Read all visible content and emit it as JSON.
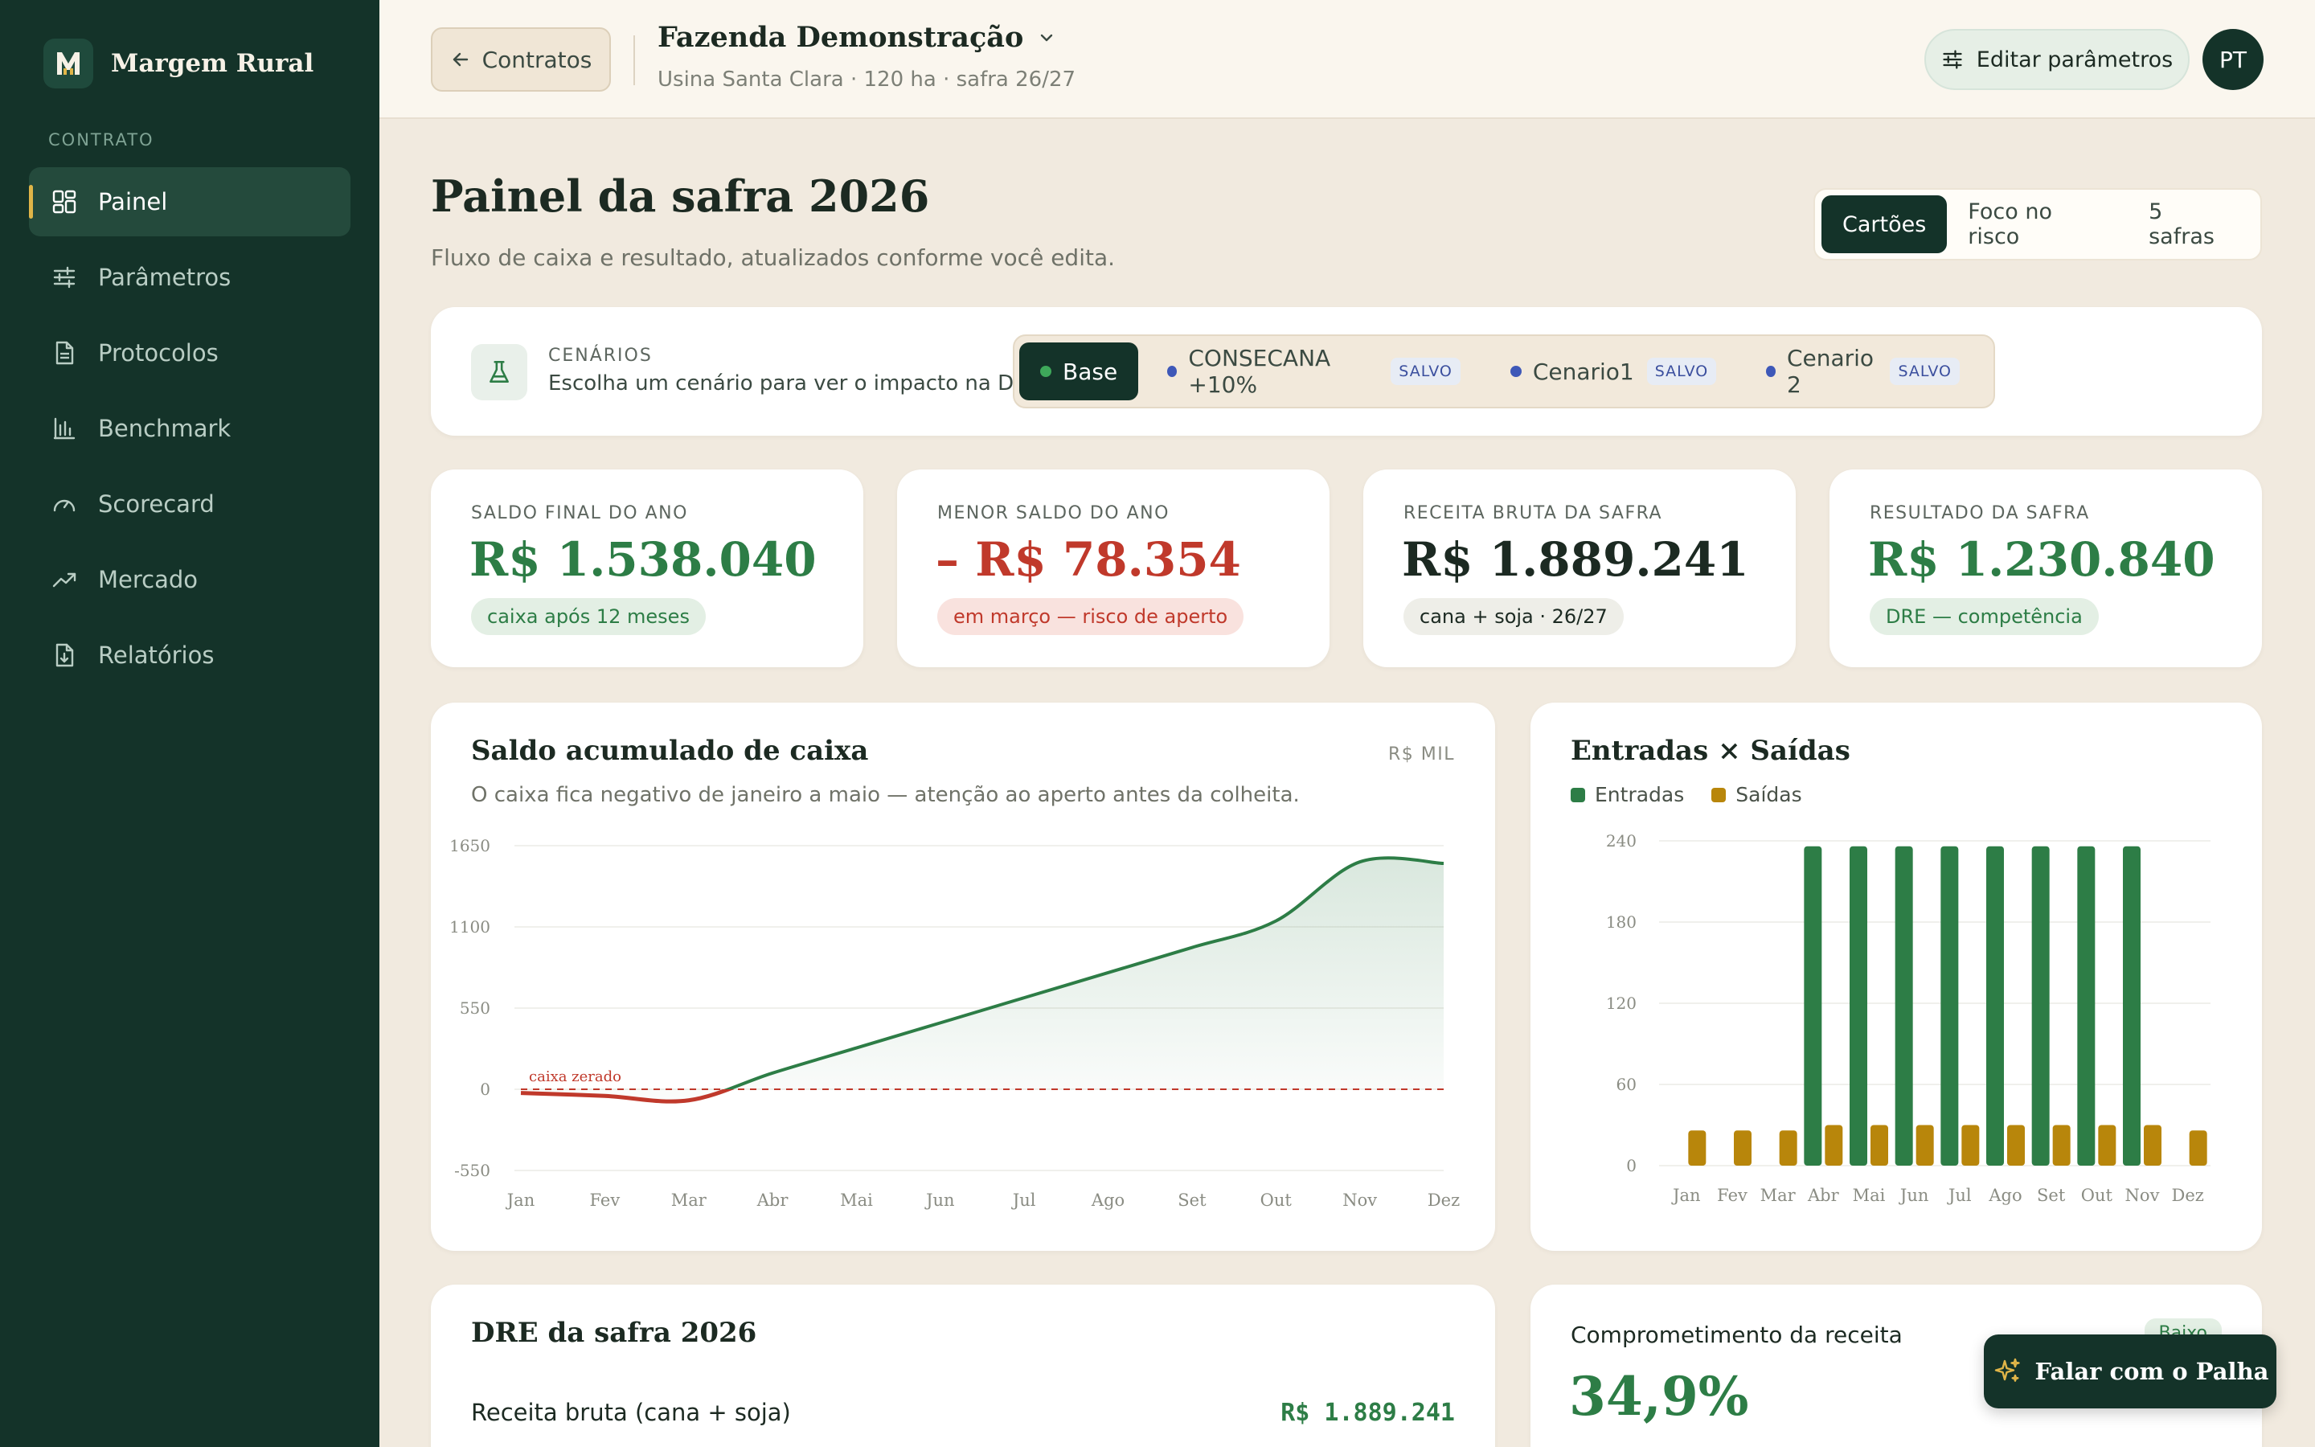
{
  "app": {
    "name": "Margem Rural",
    "logo_letter": "M"
  },
  "sidebar": {
    "section": "CONTRATO",
    "items": [
      {
        "label": "Painel",
        "icon": "dashboard-icon",
        "active": true
      },
      {
        "label": "Parâmetros",
        "icon": "sliders-icon"
      },
      {
        "label": "Protocolos",
        "icon": "document-icon"
      },
      {
        "label": "Benchmark",
        "icon": "bar-chart-icon"
      },
      {
        "label": "Scorecard",
        "icon": "gauge-icon"
      },
      {
        "label": "Mercado",
        "icon": "trending-up-icon"
      },
      {
        "label": "Relatórios",
        "icon": "report-download-icon"
      }
    ]
  },
  "topbar": {
    "back_label": "Contratos",
    "farm_name": "Fazenda Demonstração",
    "farm_sub": "Usina Santa Clara · 120 ha · safra 26/27",
    "edit_label": "Editar parâmetros",
    "avatar_initials": "PT"
  },
  "page": {
    "title": "Painel da safra 2026",
    "subtitle": "Fluxo de caixa e resultado, atualizados conforme você edita.",
    "views": [
      "Cartões",
      "Foco no risco",
      "5 safras"
    ],
    "active_view": "Cartões"
  },
  "scenarios": {
    "label": "CENÁRIOS",
    "description": "Escolha um cenário para ver o impacto na DRE.",
    "items": [
      {
        "name": "Base",
        "active": true,
        "dot": "#3ea85a",
        "badge": ""
      },
      {
        "name": "CONSECANA +10%",
        "active": false,
        "dot": "#3e58b8",
        "badge": "SALVO"
      },
      {
        "name": "Cenario1",
        "active": false,
        "dot": "#3e58b8",
        "badge": "SALVO"
      },
      {
        "name": "Cenario 2",
        "active": false,
        "dot": "#3e58b8",
        "badge": "SALVO"
      }
    ]
  },
  "kpis": [
    {
      "label": "SALDO FINAL DO ANO",
      "value": "R$ 1.538.040",
      "pill": "caixa após 12 meses",
      "tone": "green"
    },
    {
      "label": "MENOR SALDO DO ANO",
      "value": "– R$ 78.354",
      "pill": "em março — risco de aperto",
      "tone": "red"
    },
    {
      "label": "RECEITA BRUTA DA SAFRA",
      "value": "R$ 1.889.241",
      "pill": "cana + soja · 26/27",
      "tone": "neutral"
    },
    {
      "label": "RESULTADO DA SAFRA",
      "value": "R$ 1.230.840",
      "pill": "DRE — competência",
      "tone": "green"
    }
  ],
  "colors": {
    "green": "#2d7d46",
    "red": "#c0392b",
    "gold": "#b8860b",
    "dark": "#143329"
  },
  "cash_chart": {
    "title": "Saldo acumulado de caixa",
    "unit": "R$ MIL",
    "subtitle": "O caixa fica negativo de janeiro a maio — atenção ao aperto antes da colheita.",
    "zero_label": "caixa zerado"
  },
  "flow_chart": {
    "title": "Entradas × Saídas",
    "legend": [
      "Entradas",
      "Saídas"
    ]
  },
  "chart_data": [
    {
      "type": "area",
      "title": "Saldo acumulado de caixa",
      "ylabel": "R$ MIL",
      "x": [
        "Jan",
        "Fev",
        "Mar",
        "Abr",
        "Mai",
        "Jun",
        "Jul",
        "Ago",
        "Set",
        "Out",
        "Nov",
        "Dez"
      ],
      "series": [
        {
          "values": [
            -25,
            -45,
            -75,
            110,
            280,
            450,
            620,
            790,
            960,
            1140,
            1540,
            1530
          ]
        }
      ],
      "yticks": [
        -550,
        0,
        550,
        1100,
        1650
      ],
      "ylim": [
        -550,
        1650
      ],
      "reference_line": {
        "y": 0,
        "label": "caixa zerado"
      },
      "grid": true
    },
    {
      "type": "bar",
      "title": "Entradas × Saídas",
      "categories": [
        "Jan",
        "Fev",
        "Mar",
        "Abr",
        "Mai",
        "Jun",
        "Jul",
        "Ago",
        "Set",
        "Out",
        "Nov",
        "Dez"
      ],
      "series": [
        {
          "name": "Entradas",
          "values": [
            0,
            0,
            0,
            236,
            236,
            236,
            236,
            236,
            236,
            236,
            236,
            0
          ]
        },
        {
          "name": "Saídas",
          "values": [
            26,
            26,
            26,
            30,
            30,
            30,
            30,
            30,
            30,
            30,
            30,
            26
          ]
        }
      ],
      "yticks": [
        0,
        60,
        120,
        180,
        240
      ],
      "ylim": [
        0,
        240
      ],
      "legend": "top-left",
      "grid": true
    }
  ],
  "dre": {
    "title": "DRE da safra 2026",
    "row_label": "Receita bruta (cana + soja)",
    "row_value": "R$ 1.889.241"
  },
  "commitment": {
    "title": "Comprometimento da receita",
    "badge": "Baixo",
    "value": "34,9%"
  },
  "fab": {
    "label": "Falar com o Palha"
  }
}
